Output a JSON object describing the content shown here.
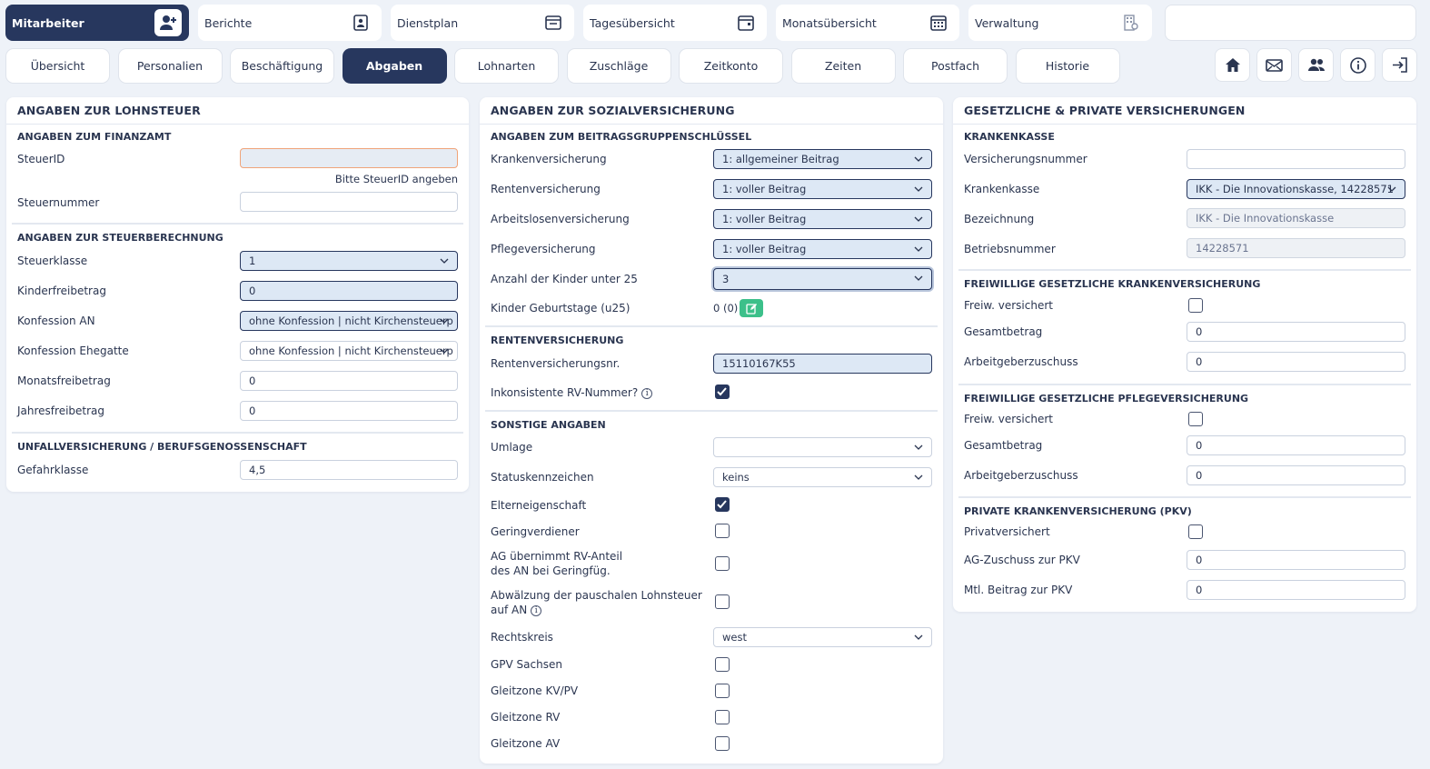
{
  "top_nav": [
    {
      "label": "Mitarbeiter",
      "icon": "user-plus-icon",
      "active": true
    },
    {
      "label": "Berichte",
      "icon": "report-icon"
    },
    {
      "label": "Dienstplan",
      "icon": "roster-icon"
    },
    {
      "label": "Tagesübersicht",
      "icon": "day-calendar-icon"
    },
    {
      "label": "Monatsübersicht",
      "icon": "month-calendar-icon"
    },
    {
      "label": "Verwaltung",
      "icon": "building-settings-icon"
    }
  ],
  "tabs": [
    "Übersicht",
    "Personalien",
    "Beschäftigung",
    "Abgaben",
    "Lohnarten",
    "Zuschläge",
    "Zeitkonto",
    "Zeiten",
    "Postfach",
    "Historie"
  ],
  "active_tab": "Abgaben",
  "toolbar_icons": [
    "home-icon",
    "mail-icon",
    "users-icon",
    "info-icon",
    "logout-icon"
  ],
  "colors": {
    "primary": "#27375e",
    "accent_green": "#3cc08a",
    "error_border": "#f0a47a"
  },
  "lohnsteuer": {
    "title": "ANGABEN ZUR LOHNSTEUER",
    "finanzamt": "ANGABEN ZUM FINANZAMT",
    "steuerid_label": "SteuerID",
    "steuerid_value": "",
    "steuerid_hint": "Bitte SteuerID angeben",
    "steuernummer_label": "Steuernummer",
    "steuernummer_value": "",
    "steuerberechnung": "ANGABEN ZUR STEUERBERECHNUNG",
    "steuerklasse_label": "Steuerklasse",
    "steuerklasse_value": "1",
    "kinderfreibetrag_label": "Kinderfreibetrag",
    "kinderfreibetrag_value": "0",
    "konfession_an_label": "Konfession AN",
    "konfession_an_value": "ohne Konfession | nicht Kirchensteuerp",
    "konfession_ehegatte_label": "Konfession Ehegatte",
    "konfession_ehegatte_value": "ohne Konfession | nicht Kirchensteuerp",
    "monatsfreibetrag_label": "Monatsfreibetrag",
    "monatsfreibetrag_value": "0",
    "jahresfreibetrag_label": "Jahresfreibetrag",
    "jahresfreibetrag_value": "0",
    "unfall": "UNFALLVERSICHERUNG / BERUFSGENOSSENSCHAFT",
    "gefahrklasse_label": "Gefahrklasse",
    "gefahrklasse_value": "4,5"
  },
  "sozial": {
    "title": "ANGABEN ZUR SOZIALVERSICHERUNG",
    "bgs": "ANGABEN ZUM BEITRAGSGRUPPENSCHLÜSSEL",
    "kv_label": "Krankenversicherung",
    "kv_value": "1: allgemeiner Beitrag",
    "rv_label": "Rentenversicherung",
    "rv_value": "1: voller Beitrag",
    "av_label": "Arbeitslosenversicherung",
    "av_value": "1: voller Beitrag",
    "pv_label": "Pflegeversicherung",
    "pv_value": "1: voller Beitrag",
    "kinder_label": "Anzahl der Kinder unter 25",
    "kinder_value": "3",
    "geburtstage_label": "Kinder Geburtstage (u25)",
    "geburtstage_value": "0 (0)",
    "rentenversicherung": "RENTENVERSICHERUNG",
    "rvnr_label": "Rentenversicherungsnr.",
    "rvnr_value": "15110167K55",
    "inkonsistent_label": "Inkonsistente RV-Nummer?",
    "inkonsistent_checked": true,
    "sonstige": "SONSTIGE ANGABEN",
    "umlage_label": "Umlage",
    "umlage_value": "",
    "status_label": "Statuskennzeichen",
    "status_value": "keins",
    "eltern_label": "Elterneigenschaft",
    "eltern_checked": true,
    "gering_label": "Geringverdiener",
    "gering_checked": false,
    "ag_rv_label": "AG übernimmt RV-Anteil des AN bei Geringfüg.",
    "ag_rv_checked": false,
    "abwaelzung_label": "Abwälzung der pauschalen Lohnsteuer auf AN",
    "abwaelzung_checked": false,
    "rechtskreis_label": "Rechtskreis",
    "rechtskreis_value": "west",
    "gpv_label": "GPV Sachsen",
    "gz_kvpv_label": "Gleitzone KV/PV",
    "gz_rv_label": "Gleitzone RV",
    "gz_av_label": "Gleitzone AV"
  },
  "versicherungen": {
    "title": "GESETZLICHE & PRIVATE VERSICHERUNGEN",
    "krankenkasse": "KRANKENKASSE",
    "vnr_label": "Versicherungsnummer",
    "vnr_value": "",
    "kk_label": "Krankenkasse",
    "kk_value": "IKK - Die Innovationskasse, 14228571",
    "bez_label": "Bezeichnung",
    "bez_value": "IKK - Die Innovationskasse",
    "bnr_label": "Betriebsnummer",
    "bnr_value": "14228571",
    "fgkv": "FREIWILLIGE GESETZLICHE KRANKENVERSICHERUNG",
    "fgkv_freiw_label": "Freiw. versichert",
    "fgkv_gesamt_label": "Gesamtbetrag",
    "fgkv_gesamt_value": "0",
    "fgkv_ag_label": "Arbeitgeberzuschuss",
    "fgkv_ag_value": "0",
    "fgpv": "FREIWILLIGE GESETZLICHE PFLEGEVERSICHERUNG",
    "fgpv_freiw_label": "Freiw. versichert",
    "fgpv_gesamt_label": "Gesamtbetrag",
    "fgpv_gesamt_value": "0",
    "fgpv_ag_label": "Arbeitgeberzuschuss",
    "fgpv_ag_value": "0",
    "pkv": "PRIVATE KRANKENVERSICHERUNG (PKV)",
    "pkv_priv_label": "Privatversichert",
    "pkv_ag_label": "AG-Zuschuss zur PKV",
    "pkv_ag_value": "0",
    "pkv_mtl_label": "Mtl. Beitrag zur PKV",
    "pkv_mtl_value": "0"
  }
}
